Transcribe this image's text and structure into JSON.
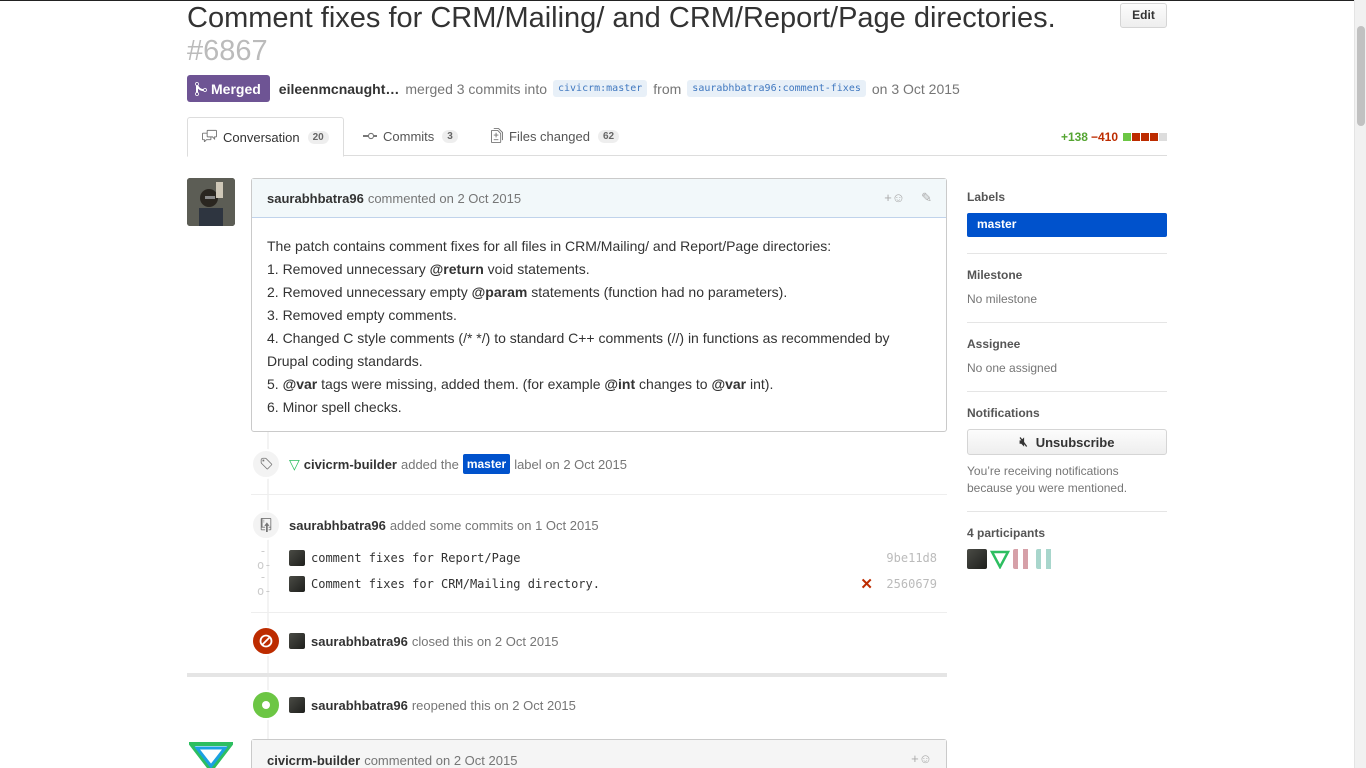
{
  "header": {
    "title": "Comment fixes for CRM/Mailing/ and CRM/Report/Page directories.",
    "number": "#6867",
    "edit_label": "Edit"
  },
  "meta": {
    "state": "Merged",
    "author": "eileenmcnaught…",
    "merged_text": "merged 3 commits into",
    "base_ref": "civicrm:master",
    "from_text": "from",
    "head_ref": "saurabhbatra96:comment-fixes",
    "date_text": "on 3 Oct 2015"
  },
  "tabs": [
    {
      "label": "Conversation",
      "count": "20",
      "icon": "comment-discussion-icon"
    },
    {
      "label": "Commits",
      "count": "3",
      "icon": "git-commit-icon"
    },
    {
      "label": "Files changed",
      "count": "62",
      "icon": "file-diff-icon"
    }
  ],
  "diffstat": {
    "additions": "+138",
    "deletions": "−410"
  },
  "comment": {
    "author": "saurabhbatra96",
    "action": "commented",
    "date": "on 2 Oct 2015",
    "lines": [
      "The patch contains comment fixes for all files in CRM/Mailing/ and Report/Page directories:",
      [
        "1. Removed unnecessary ",
        "@return",
        " void statements."
      ],
      [
        "2. Removed unnecessary empty ",
        "@param",
        " statements (function had no parameters)."
      ],
      "3. Removed empty comments.",
      "4. Changed C style comments (/* */) to standard C++ comments (//) in functions as recommended by Drupal coding standards.",
      [
        "5. ",
        "@var",
        " tags were missing, added them. (for example ",
        "@int",
        " changes to ",
        "@var",
        " int)."
      ],
      "6. Minor spell checks."
    ]
  },
  "events": {
    "label_event": {
      "actor": "civicrm-builder",
      "pre": "added the",
      "label": "master",
      "post": "label on 2 Oct 2015"
    },
    "commits_event": {
      "actor": "saurabhbatra96",
      "text": "added some commits on 1 Oct 2015"
    },
    "commits": [
      {
        "message": "comment fixes for Report/Page",
        "sha": "9be11d8",
        "failed": false
      },
      {
        "message": "Comment fixes for CRM/Mailing directory.",
        "sha": "2560679",
        "failed": true
      }
    ],
    "closed_event": {
      "actor": "saurabhbatra96",
      "text": "closed this on 2 Oct 2015"
    },
    "reopened_event": {
      "actor": "saurabhbatra96",
      "text": "reopened this on 2 Oct 2015"
    }
  },
  "comment2": {
    "author": "civicrm-builder",
    "action": "commented",
    "date": "on 2 Oct 2015"
  },
  "sidebar": {
    "labels_title": "Labels",
    "label": "master",
    "milestone_title": "Milestone",
    "milestone_value": "No milestone",
    "assignee_title": "Assignee",
    "assignee_value": "No one assigned",
    "notifications_title": "Notifications",
    "unsubscribe_label": "Unsubscribe",
    "notifications_reason": "You’re receiving notifications because you were mentioned.",
    "participants_title": "4 participants"
  },
  "colors": {
    "merged": "#6e5494",
    "label": "#0052cc",
    "closed": "#bd2c00",
    "open": "#6cc644"
  }
}
